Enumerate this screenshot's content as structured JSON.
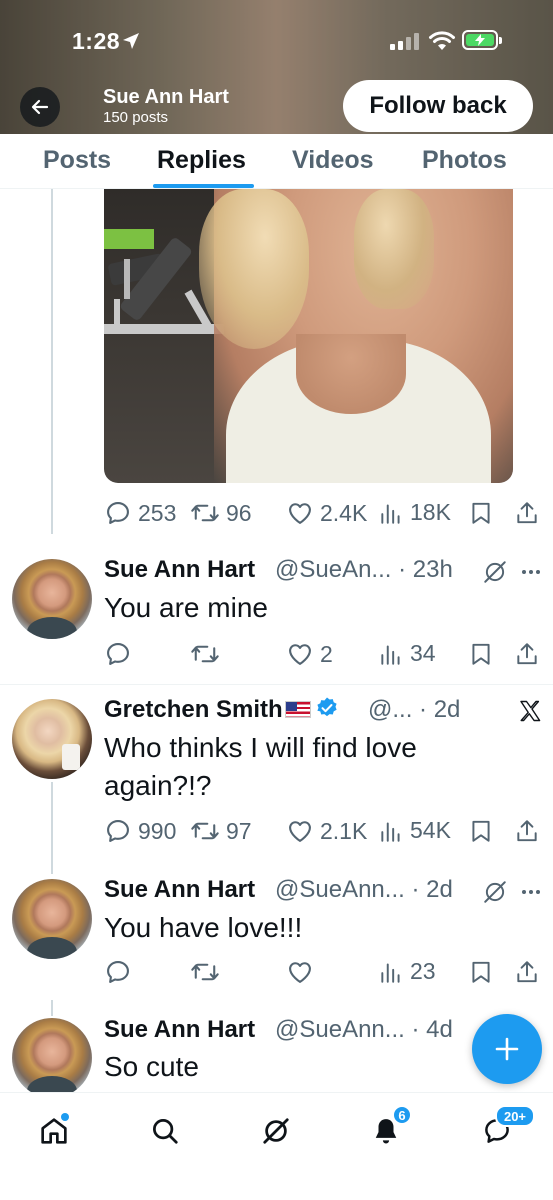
{
  "status_bar": {
    "time": "1:28"
  },
  "header": {
    "name": "Sue Ann Hart",
    "posts": "150 posts",
    "follow_label": "Follow back"
  },
  "tabs": [
    {
      "label": "Posts",
      "active": false
    },
    {
      "label": "Replies",
      "active": true
    },
    {
      "label": "Videos",
      "active": false
    },
    {
      "label": "Photos",
      "active": false
    }
  ],
  "media_post_actions": {
    "replies": "253",
    "reposts": "96",
    "likes": "2.4K",
    "views": "18K"
  },
  "tweets": [
    {
      "name": "Sue Ann Hart",
      "meta": "@SueAn... · 23h",
      "text": "You are mine",
      "replies": "",
      "reposts": "",
      "likes": "2",
      "views": "34"
    },
    {
      "name": "Gretchen Smith",
      "meta": "@... · 2d",
      "text": "Who thinks I will find love again?!?",
      "replies": "990",
      "reposts": "97",
      "likes": "2.1K",
      "views": "54K"
    },
    {
      "name": "Sue Ann Hart",
      "meta": "@SueAnn... · 2d",
      "text": "You have love!!!",
      "replies": "",
      "reposts": "",
      "likes": "",
      "views": "23"
    },
    {
      "name": "Sue Ann Hart",
      "meta": "@SueAnn... · 4d",
      "text": "So cute"
    }
  ],
  "bottom_nav": {
    "notifications_badge": "6",
    "messages_badge": "20+"
  },
  "colors": {
    "accent": "#1d9bf0",
    "text": "#0f1419",
    "muted": "#536471"
  }
}
